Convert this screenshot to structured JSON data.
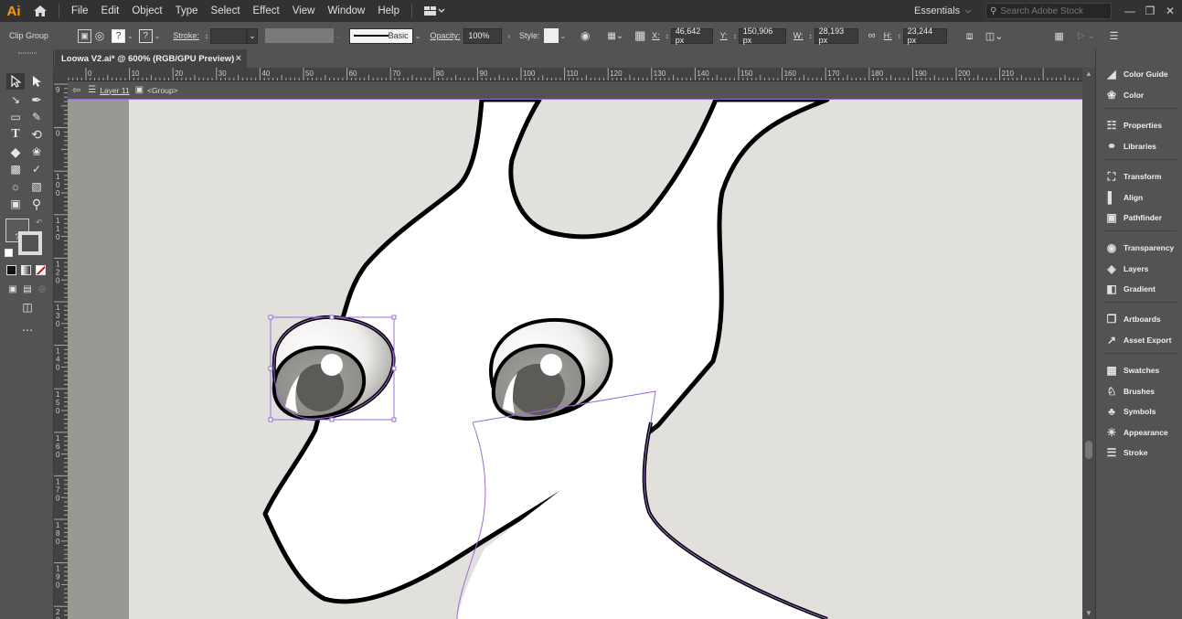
{
  "app": {
    "logo": "Ai",
    "menu": [
      "File",
      "Edit",
      "Object",
      "Type",
      "Select",
      "Effect",
      "View",
      "Window",
      "Help"
    ],
    "workspace": "Essentials",
    "search_placeholder": "Search Adobe Stock"
  },
  "control_bar": {
    "selection_type": "Clip Group",
    "stroke_label": "Stroke:",
    "brush_style": "Basic",
    "opacity_label": "Opacity:",
    "opacity_value": "100%",
    "style_label": "Style:",
    "x_label": "X:",
    "x_value": "46,642 px",
    "y_label": "Y:",
    "y_value": "150,906 px",
    "w_label": "W:",
    "w_value": "28,193 px",
    "h_label": "H:",
    "h_value": "23,244 px"
  },
  "document": {
    "tab_title": "Loowa V2.ai* @ 600% (RGB/GPU Preview)",
    "close_glyph": "×"
  },
  "isolation": {
    "layer": "Layer 11",
    "group": "<Group>"
  },
  "ruler_top_ticks": [
    "10",
    "0",
    "10",
    "20",
    "30",
    "40",
    "50",
    "60",
    "70",
    "80",
    "90",
    "100",
    "110",
    "120",
    "130",
    "140",
    "150",
    "160",
    "170",
    "180",
    "190",
    "200",
    "210"
  ],
  "ruler_left_ticks": [
    "9",
    "0",
    "100",
    "110",
    "120",
    "130",
    "140",
    "150",
    "160",
    "170",
    "180",
    "190",
    "200"
  ],
  "panels": [
    {
      "label": "Color Guide",
      "icon": "color-guide-icon"
    },
    {
      "label": "Color",
      "icon": "color-icon"
    },
    {
      "label": "Properties",
      "icon": "properties-icon"
    },
    {
      "label": "Libraries",
      "icon": "libraries-icon"
    },
    {
      "label": "Transform",
      "icon": "transform-icon"
    },
    {
      "label": "Align",
      "icon": "align-icon"
    },
    {
      "label": "Pathfinder",
      "icon": "pathfinder-icon"
    },
    {
      "label": "Transparency",
      "icon": "transparency-icon"
    },
    {
      "label": "Layers",
      "icon": "layers-icon"
    },
    {
      "label": "Gradient",
      "icon": "gradient-icon"
    },
    {
      "label": "Artboards",
      "icon": "artboards-icon"
    },
    {
      "label": "Asset Export",
      "icon": "asset-export-icon"
    },
    {
      "label": "Swatches",
      "icon": "swatches-icon"
    },
    {
      "label": "Brushes",
      "icon": "brushes-icon"
    },
    {
      "label": "Symbols",
      "icon": "symbols-icon"
    },
    {
      "label": "Appearance",
      "icon": "appearance-icon"
    },
    {
      "label": "Stroke",
      "icon": "stroke-icon"
    }
  ],
  "colors": {
    "selection": "#9b6bd6",
    "artboard_bg": "#e2e0dc",
    "pasteboard": "#999892"
  }
}
